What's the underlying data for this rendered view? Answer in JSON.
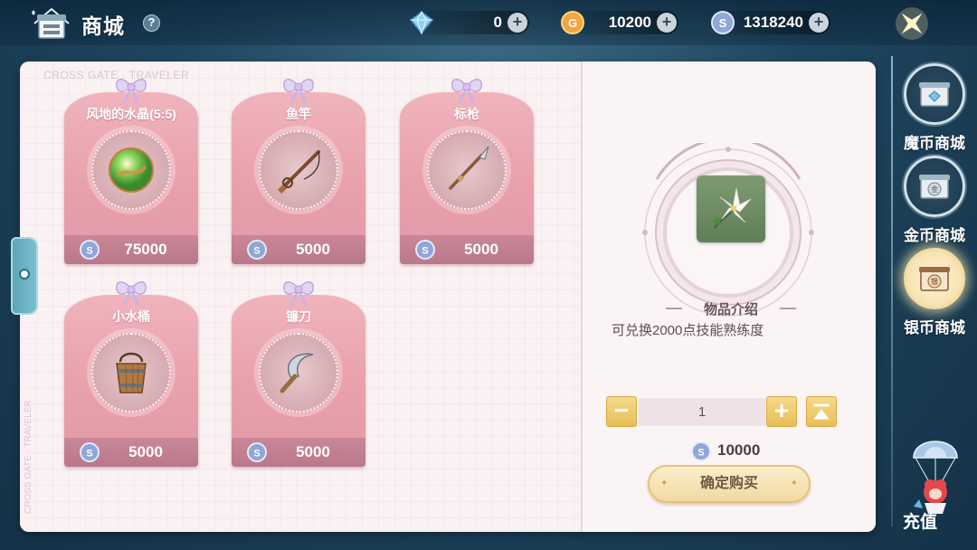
{
  "header": {
    "title": "商城",
    "help_label": "?",
    "currencies": [
      {
        "name": "crystal",
        "icon": "crystal-icon",
        "value": "0",
        "add_label": "+"
      },
      {
        "name": "gold",
        "icon": "gold-coin-icon",
        "value": "10200",
        "add_label": "+"
      },
      {
        "name": "silver",
        "icon": "silver-coin-icon",
        "value": "1318240",
        "add_label": "+"
      }
    ]
  },
  "book": {
    "watermark": "CROSS GATE · TRAVELER",
    "watermark_side": "CROSS GATE · TRAVELER"
  },
  "items": [
    {
      "name": "风地的水晶(5:5)",
      "icon": "crystal-orb-icon",
      "price": "75000"
    },
    {
      "name": "鱼竿",
      "icon": "fishing-rod-icon",
      "price": "5000"
    },
    {
      "name": "标枪",
      "icon": "javelin-icon",
      "price": "5000"
    },
    {
      "name": "小水桶",
      "icon": "bucket-icon",
      "price": "5000"
    },
    {
      "name": "镰刀",
      "icon": "sickle-icon",
      "price": "5000"
    }
  ],
  "detail": {
    "icon": "white-flower-icon",
    "section_title": "物品介绍",
    "description": "可兑换2000点技能熟练度",
    "quantity": "1",
    "minus_label": "−",
    "plus_label": "+",
    "total": "10000",
    "buy_label": "确定购买"
  },
  "nav": [
    {
      "label": "魔币商城",
      "icon": "magic-coin-shop-icon",
      "active": false
    },
    {
      "label": "金币商城",
      "icon": "gold-coin-shop-icon",
      "active": false
    },
    {
      "label": "银币商城",
      "icon": "silver-coin-shop-icon",
      "active": true
    }
  ],
  "recharge": {
    "label": "充值",
    "icon": "parachute-mascot-icon"
  },
  "colors": {
    "card_pink": "#e8a0aa",
    "price_bar": "#b9788b",
    "button_gold": "#e8bd57",
    "background": "#1f4660"
  }
}
